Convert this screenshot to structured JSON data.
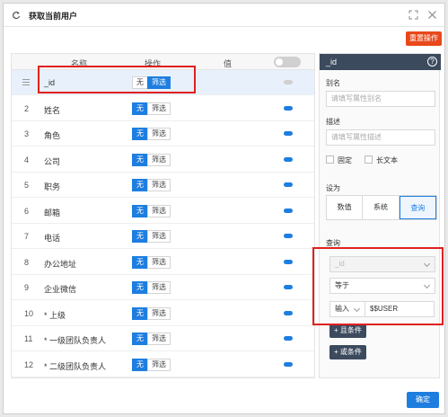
{
  "dialog": {
    "title": "获取当前用户",
    "reset_label": "重置操作",
    "ok_label": "确定"
  },
  "grid": {
    "headers": {
      "name": "名称",
      "action": "操作",
      "value": "值"
    },
    "seg": {
      "none": "无",
      "filter": "筛选"
    },
    "rows": [
      {
        "num": "",
        "name": "_id",
        "selected": true,
        "none_on": false,
        "toggle": false
      },
      {
        "num": "2",
        "name": "姓名",
        "selected": false,
        "none_on": true,
        "toggle": true
      },
      {
        "num": "3",
        "name": "角色",
        "selected": false,
        "none_on": true,
        "toggle": true
      },
      {
        "num": "4",
        "name": "公司",
        "selected": false,
        "none_on": true,
        "toggle": true
      },
      {
        "num": "5",
        "name": "职务",
        "selected": false,
        "none_on": true,
        "toggle": true
      },
      {
        "num": "6",
        "name": "邮箱",
        "selected": false,
        "none_on": true,
        "toggle": true
      },
      {
        "num": "7",
        "name": "电话",
        "selected": false,
        "none_on": true,
        "toggle": true
      },
      {
        "num": "8",
        "name": "办公地址",
        "selected": false,
        "none_on": true,
        "toggle": true
      },
      {
        "num": "9",
        "name": "企业微信",
        "selected": false,
        "none_on": true,
        "toggle": true
      },
      {
        "num": "10",
        "name": "* 上级",
        "selected": false,
        "none_on": true,
        "toggle": true
      },
      {
        "num": "11",
        "name": "* 一级团队负责人",
        "selected": false,
        "none_on": true,
        "toggle": true
      },
      {
        "num": "12",
        "name": "* 二级团队负责人",
        "selected": false,
        "none_on": true,
        "toggle": true
      }
    ]
  },
  "side": {
    "title": "_id",
    "alias_label": "别名",
    "alias_placeholder": "请填写属性别名",
    "desc_label": "描述",
    "desc_placeholder": "请填写属性描述",
    "fixed_label": "固定",
    "longtext_label": "长文本",
    "setas_label": "设为",
    "setas_options": [
      "数值",
      "系统",
      "查询"
    ],
    "query_label": "查询",
    "query_field": "_id",
    "query_op": "等于",
    "query_input_type": "输入",
    "query_value": "$$USER",
    "and_btn": "+ 且条件",
    "or_btn": "+ 或条件"
  }
}
